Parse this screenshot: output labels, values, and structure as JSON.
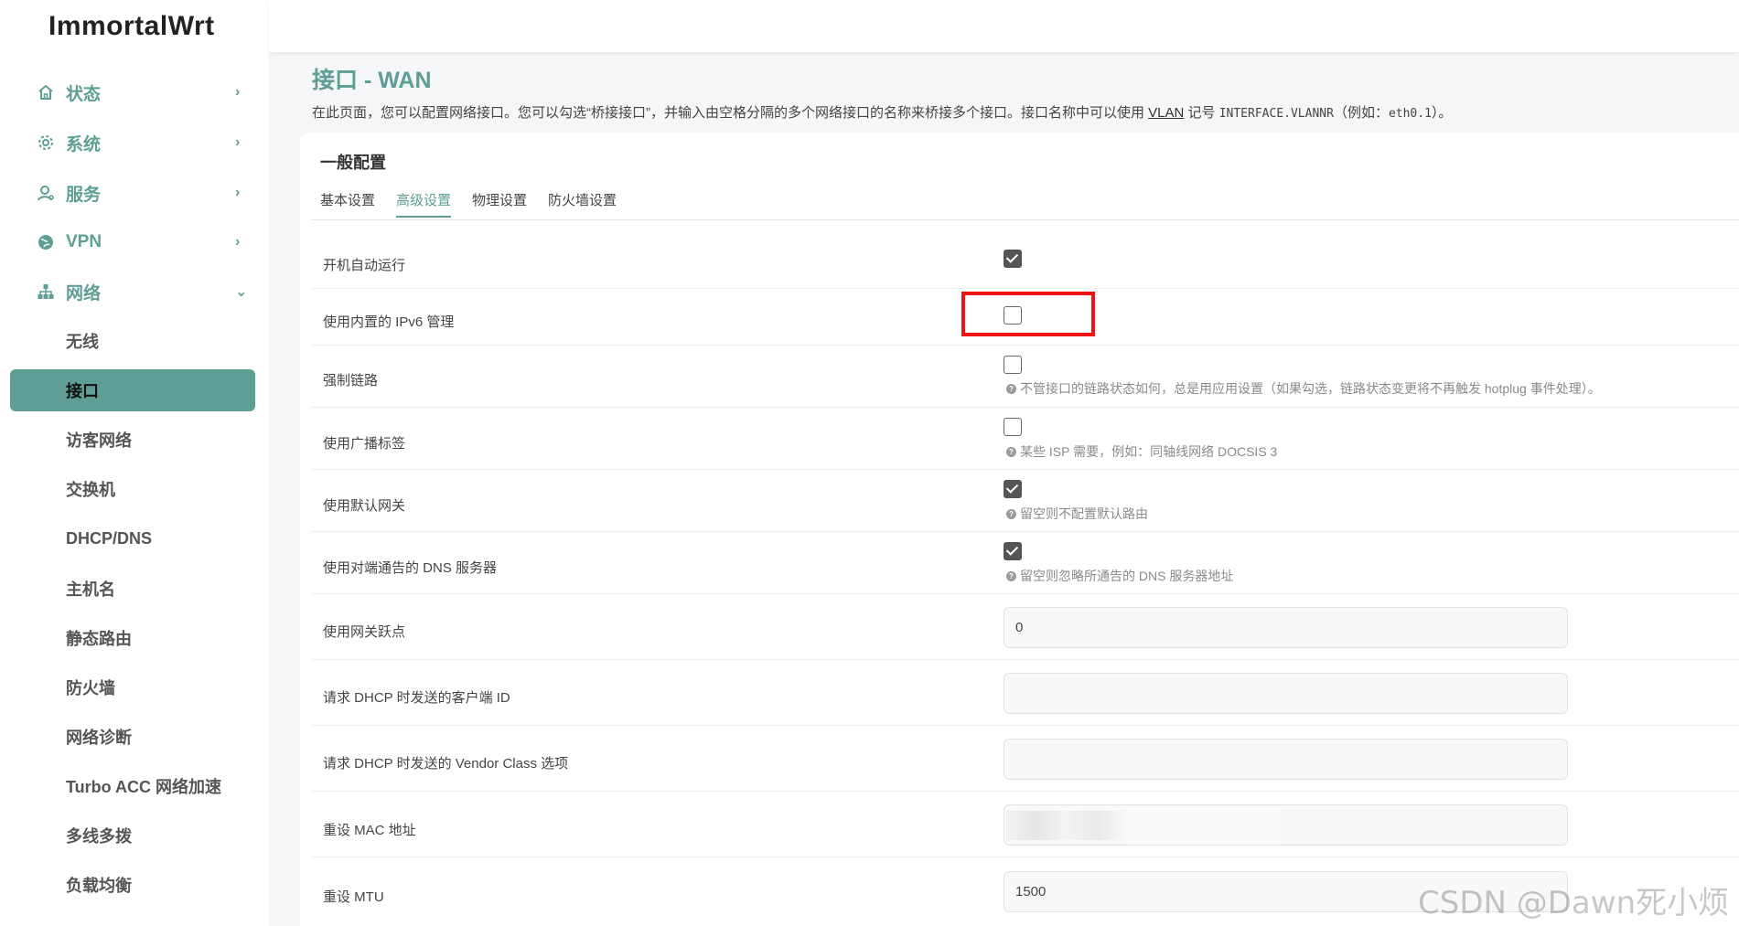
{
  "brand": "ImmortalWrt",
  "nav": {
    "main": [
      {
        "label": "状态",
        "icon": "home-icon",
        "chevron": "›"
      },
      {
        "label": "系统",
        "icon": "gear-icon",
        "chevron": "›"
      },
      {
        "label": "服务",
        "icon": "user-icon",
        "chevron": "›"
      },
      {
        "label": "VPN",
        "icon": "globe-icon",
        "chevron": "›"
      },
      {
        "label": "网络",
        "icon": "network-icon",
        "chevron": "⌄"
      }
    ],
    "sub": [
      {
        "label": "无线",
        "active": false
      },
      {
        "label": "接口",
        "active": true
      },
      {
        "label": "访客网络",
        "active": false
      },
      {
        "label": "交换机",
        "active": false
      },
      {
        "label": "DHCP/DNS",
        "active": false
      },
      {
        "label": "主机名",
        "active": false
      },
      {
        "label": "静态路由",
        "active": false
      },
      {
        "label": "防火墙",
        "active": false
      },
      {
        "label": "网络诊断",
        "active": false
      },
      {
        "label": "Turbo ACC 网络加速",
        "active": false
      },
      {
        "label": "多线多拨",
        "active": false
      },
      {
        "label": "负载均衡",
        "active": false
      }
    ]
  },
  "page": {
    "title": "接口 - WAN",
    "desc_part1": "在此页面，您可以配置网络接口。您可以勾选“桥接接口”，并输入由空格分隔的多个网络接口的名称来桥接多个接口。接口名称中可以使用 ",
    "desc_vlan": "VLAN",
    "desc_part2": " 记号 ",
    "desc_mono1": "INTERFACE.VLANNR",
    "desc_part3": "（例如：",
    "desc_mono2": "eth0.1",
    "desc_part4": "）。"
  },
  "section": {
    "title": "一般配置",
    "tabs": [
      {
        "label": "基本设置",
        "active": false
      },
      {
        "label": "高级设置",
        "active": true
      },
      {
        "label": "物理设置",
        "active": false
      },
      {
        "label": "防火墙设置",
        "active": false
      }
    ]
  },
  "rows": [
    {
      "label": "开机自动运行",
      "type": "checkbox",
      "checked": true,
      "hint": ""
    },
    {
      "label": "使用内置的 IPv6 管理",
      "type": "checkbox",
      "checked": false,
      "hint": ""
    },
    {
      "label": "强制链路",
      "type": "checkbox",
      "checked": false,
      "hint": "不管接口的链路状态如何，总是用应用设置（如果勾选，链路状态变更将不再触发 hotplug 事件处理）。"
    },
    {
      "label": "使用广播标签",
      "type": "checkbox",
      "checked": false,
      "hint": "某些 ISP 需要，例如：同轴线网络 DOCSIS 3"
    },
    {
      "label": "使用默认网关",
      "type": "checkbox",
      "checked": true,
      "hint": "留空则不配置默认路由"
    },
    {
      "label": "使用对端通告的 DNS 服务器",
      "type": "checkbox",
      "checked": true,
      "hint": "留空则忽略所通告的 DNS 服务器地址"
    },
    {
      "label": "使用网关跃点",
      "type": "input",
      "value": "0"
    },
    {
      "label": "请求 DHCP 时发送的客户端 ID",
      "type": "input",
      "value": ""
    },
    {
      "label": "请求 DHCP 时发送的 Vendor Class 选项",
      "type": "input",
      "value": ""
    },
    {
      "label": "重设 MAC 地址",
      "type": "input",
      "value": ""
    },
    {
      "label": "重设 MTU",
      "type": "input",
      "value": "1500"
    }
  ],
  "watermark": "CSDN @Dawn死小烦",
  "colors": {
    "accent": "#5e9e94",
    "highlight": "#f01414"
  }
}
